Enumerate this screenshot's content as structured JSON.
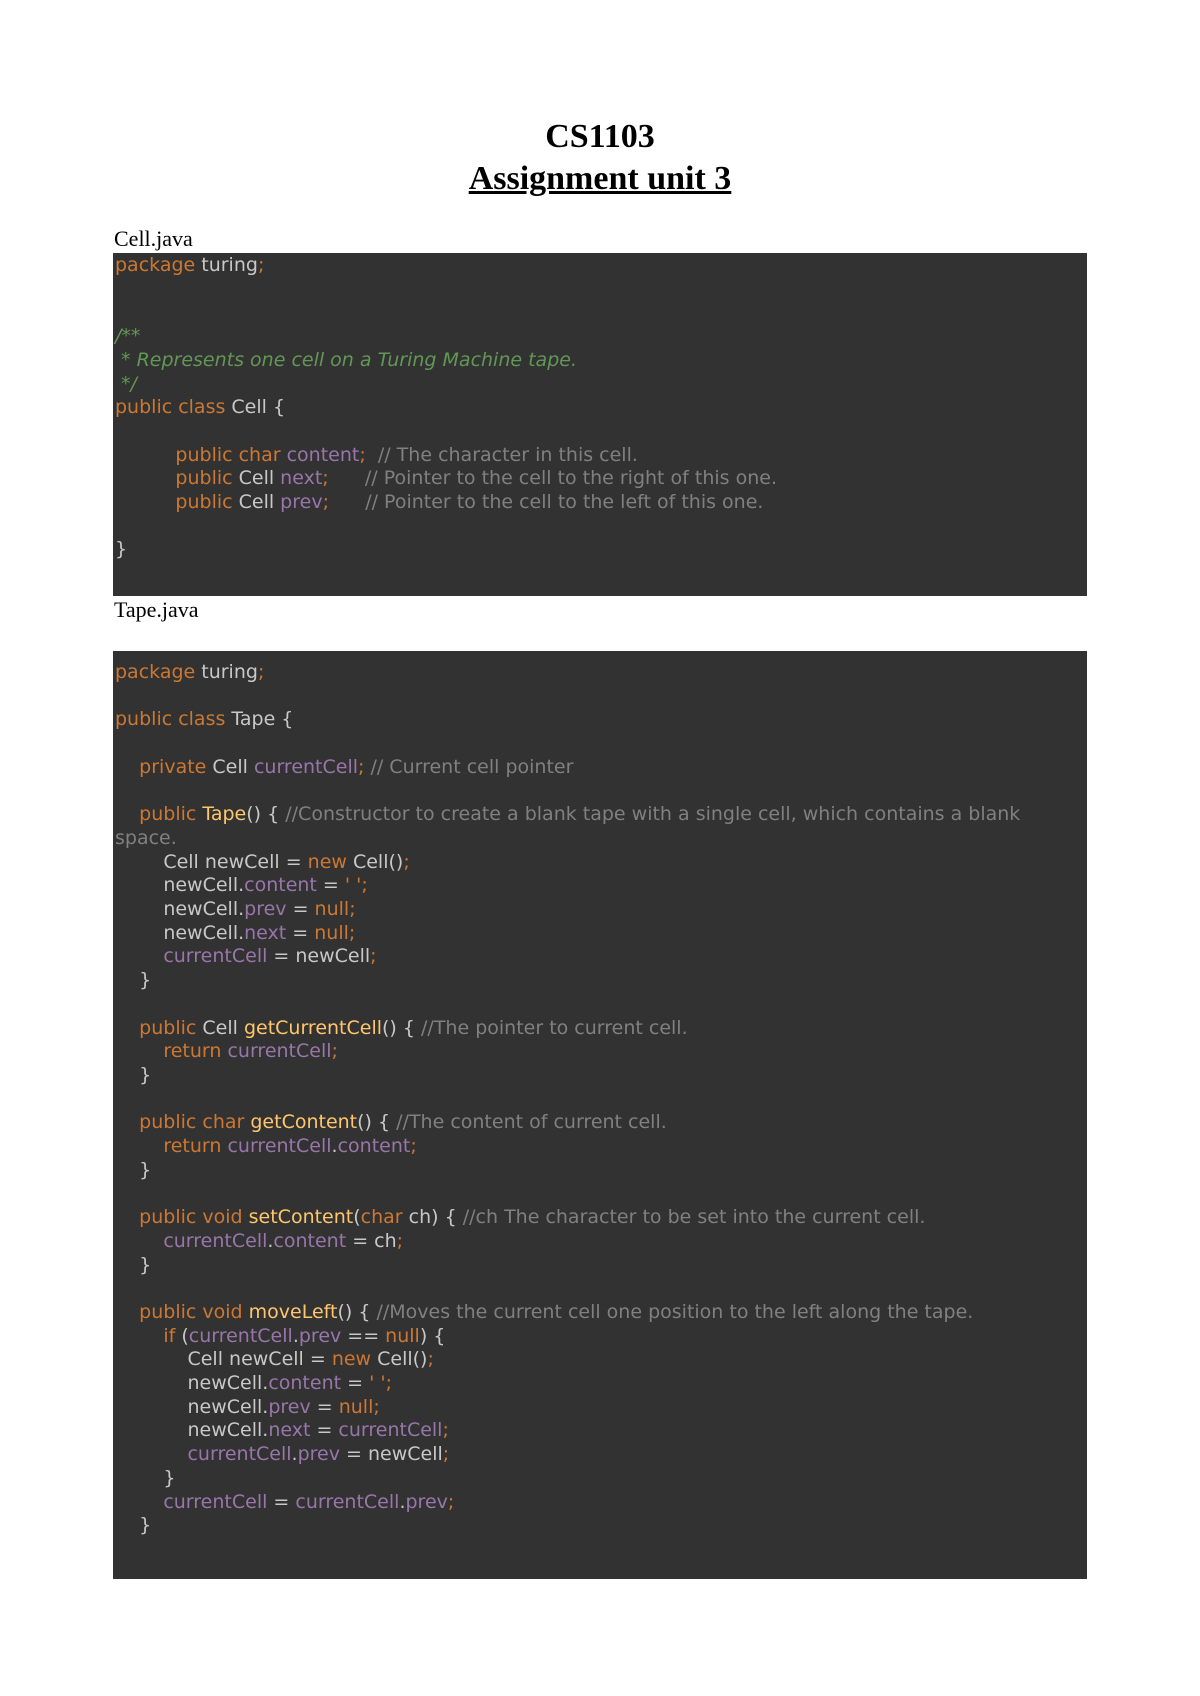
{
  "header": {
    "course": "CS1103",
    "subtitle": "Assignment unit 3"
  },
  "files": [
    {
      "label": "Cell.java",
      "lines": [
        [
          [
            "kw",
            "package"
          ],
          [
            "tx",
            " turing"
          ],
          [
            "kw",
            ";"
          ]
        ],
        [],
        [],
        [
          [
            "doc",
            "/**"
          ]
        ],
        [
          [
            "doc",
            " * Represents one cell on a Turing Machine tape."
          ]
        ],
        [
          [
            "doc",
            " */"
          ]
        ],
        [
          [
            "kw",
            "public class"
          ],
          [
            "tx",
            " Cell {"
          ]
        ],
        [],
        [
          [
            "tx",
            "          "
          ],
          [
            "kw",
            "public char"
          ],
          [
            "fld",
            " content"
          ],
          [
            "kw",
            ";"
          ],
          [
            "cm",
            "  // The character in this cell."
          ]
        ],
        [
          [
            "tx",
            "          "
          ],
          [
            "kw",
            "public"
          ],
          [
            "tx",
            " Cell "
          ],
          [
            "fld",
            "next"
          ],
          [
            "kw",
            ";"
          ],
          [
            "cm",
            "      // Pointer to the cell to the right of this one."
          ]
        ],
        [
          [
            "tx",
            "          "
          ],
          [
            "kw",
            "public"
          ],
          [
            "tx",
            " Cell "
          ],
          [
            "fld",
            "prev"
          ],
          [
            "kw",
            ";"
          ],
          [
            "cm",
            "      // Pointer to the cell to the left of this one."
          ]
        ],
        [],
        [
          [
            "tx",
            "}"
          ]
        ]
      ]
    },
    {
      "label": "Tape.java",
      "lines": [
        [
          [
            "kw",
            "package"
          ],
          [
            "tx",
            " turing"
          ],
          [
            "kw",
            ";"
          ]
        ],
        [],
        [
          [
            "kw",
            "public class"
          ],
          [
            "tx",
            " Tape {"
          ]
        ],
        [],
        [
          [
            "tx",
            "    "
          ],
          [
            "kw",
            "private"
          ],
          [
            "tx",
            " Cell "
          ],
          [
            "fld",
            "currentCell"
          ],
          [
            "kw",
            ";"
          ],
          [
            "cm",
            " // Current cell pointer"
          ]
        ],
        [],
        [
          [
            "tx",
            "    "
          ],
          [
            "kw",
            "public"
          ],
          [
            "fn",
            " Tape"
          ],
          [
            "tx",
            "() { "
          ],
          [
            "cm",
            "//Constructor to create a blank tape with a single cell, which contains a blank"
          ]
        ],
        [
          [
            "cm",
            "space."
          ]
        ],
        [
          [
            "tx",
            "        Cell newCell = "
          ],
          [
            "kw",
            "new"
          ],
          [
            "tx",
            " Cell()"
          ],
          [
            "kw",
            ";"
          ]
        ],
        [
          [
            "tx",
            "        newCell."
          ],
          [
            "fld",
            "content"
          ],
          [
            "tx",
            " = "
          ],
          [
            "kw",
            "' '"
          ],
          [
            "kw",
            ";"
          ]
        ],
        [
          [
            "tx",
            "        newCell."
          ],
          [
            "fld",
            "prev"
          ],
          [
            "tx",
            " = "
          ],
          [
            "kw",
            "null"
          ],
          [
            "kw",
            ";"
          ]
        ],
        [
          [
            "tx",
            "        newCell."
          ],
          [
            "fld",
            "next"
          ],
          [
            "tx",
            " = "
          ],
          [
            "kw",
            "null"
          ],
          [
            "kw",
            ";"
          ]
        ],
        [
          [
            "fld",
            "        currentCell"
          ],
          [
            "tx",
            " = newCell"
          ],
          [
            "kw",
            ";"
          ]
        ],
        [
          [
            "tx",
            "    }"
          ]
        ],
        [],
        [
          [
            "tx",
            "    "
          ],
          [
            "kw",
            "public"
          ],
          [
            "tx",
            " Cell "
          ],
          [
            "fn",
            "getCurrentCell"
          ],
          [
            "tx",
            "() { "
          ],
          [
            "cm",
            "//The pointer to current cell."
          ]
        ],
        [
          [
            "kw",
            "        return"
          ],
          [
            "fld",
            " currentCell"
          ],
          [
            "kw",
            ";"
          ]
        ],
        [
          [
            "tx",
            "    }"
          ]
        ],
        [],
        [
          [
            "tx",
            "    "
          ],
          [
            "kw",
            "public char"
          ],
          [
            "fn",
            " getContent"
          ],
          [
            "tx",
            "() { "
          ],
          [
            "cm",
            "//The content of current cell."
          ]
        ],
        [
          [
            "kw",
            "        return"
          ],
          [
            "fld",
            " currentCell"
          ],
          [
            "tx",
            "."
          ],
          [
            "fld",
            "content"
          ],
          [
            "kw",
            ";"
          ]
        ],
        [
          [
            "tx",
            "    }"
          ]
        ],
        [],
        [
          [
            "tx",
            "    "
          ],
          [
            "kw",
            "public void"
          ],
          [
            "fn",
            " setContent"
          ],
          [
            "tx",
            "("
          ],
          [
            "kw",
            "char"
          ],
          [
            "tx",
            " ch) { "
          ],
          [
            "cm",
            "//ch The character to be set into the current cell."
          ]
        ],
        [
          [
            "fld",
            "        currentCell"
          ],
          [
            "tx",
            "."
          ],
          [
            "fld",
            "content"
          ],
          [
            "tx",
            " = ch"
          ],
          [
            "kw",
            ";"
          ]
        ],
        [
          [
            "tx",
            "    }"
          ]
        ],
        [],
        [
          [
            "tx",
            "    "
          ],
          [
            "kw",
            "public void"
          ],
          [
            "fn",
            " moveLeft"
          ],
          [
            "tx",
            "() { "
          ],
          [
            "cm",
            "//Moves the current cell one position to the left along the tape."
          ]
        ],
        [
          [
            "kw",
            "        if"
          ],
          [
            "tx",
            " ("
          ],
          [
            "fld",
            "currentCell"
          ],
          [
            "tx",
            "."
          ],
          [
            "fld",
            "prev"
          ],
          [
            "tx",
            " == "
          ],
          [
            "kw",
            "null"
          ],
          [
            "tx",
            ") {"
          ]
        ],
        [
          [
            "tx",
            "            Cell newCell = "
          ],
          [
            "kw",
            "new"
          ],
          [
            "tx",
            " Cell()"
          ],
          [
            "kw",
            ";"
          ]
        ],
        [
          [
            "tx",
            "            newCell."
          ],
          [
            "fld",
            "content"
          ],
          [
            "tx",
            " = "
          ],
          [
            "kw",
            "' '"
          ],
          [
            "kw",
            ";"
          ]
        ],
        [
          [
            "tx",
            "            newCell."
          ],
          [
            "fld",
            "prev"
          ],
          [
            "tx",
            " = "
          ],
          [
            "kw",
            "null"
          ],
          [
            "kw",
            ";"
          ]
        ],
        [
          [
            "tx",
            "            newCell."
          ],
          [
            "fld",
            "next"
          ],
          [
            "tx",
            " = "
          ],
          [
            "fld",
            "currentCell"
          ],
          [
            "kw",
            ";"
          ]
        ],
        [
          [
            "fld",
            "            currentCell"
          ],
          [
            "tx",
            "."
          ],
          [
            "fld",
            "prev"
          ],
          [
            "tx",
            " = newCell"
          ],
          [
            "kw",
            ";"
          ]
        ],
        [
          [
            "tx",
            "        }"
          ]
        ],
        [
          [
            "fld",
            "        currentCell"
          ],
          [
            "tx",
            " = "
          ],
          [
            "fld",
            "currentCell"
          ],
          [
            "tx",
            "."
          ],
          [
            "fld",
            "prev"
          ],
          [
            "kw",
            ";"
          ]
        ],
        [
          [
            "tx",
            "    }"
          ]
        ]
      ]
    }
  ]
}
